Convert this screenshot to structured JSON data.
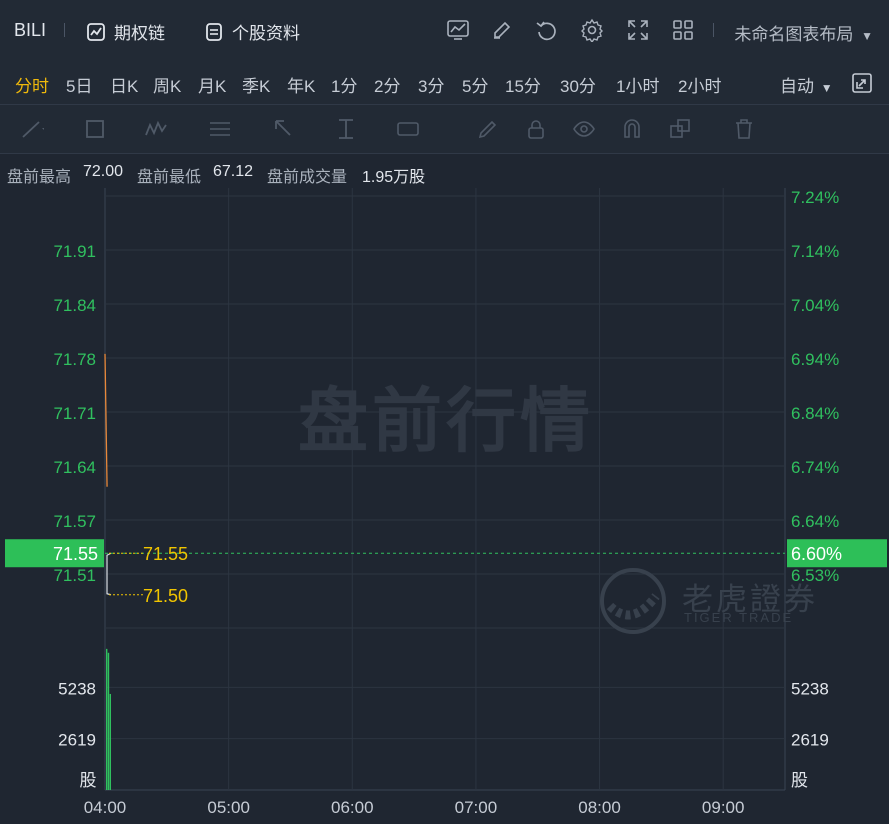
{
  "header": {
    "symbol": "BILI",
    "options_chain": "期权链",
    "stock_profile": "个股资料",
    "layout_name": "未命名图表布局"
  },
  "periods": [
    "分时",
    "5日",
    "日K",
    "周K",
    "月K",
    "季K",
    "年K",
    "1分",
    "2分",
    "3分",
    "5分",
    "15分",
    "30分",
    "1小时",
    "2小时"
  ],
  "active_period": "分时",
  "scale_mode": "自动",
  "premarket": {
    "high_label": "盘前最高",
    "high_value": "72.00",
    "low_label": "盘前最低",
    "low_value": "67.12",
    "volume_label": "盘前成交量",
    "volume_value": "1.95万股"
  },
  "watermark": "盘前行情",
  "logo": {
    "cn": "老虎證券",
    "en": "TIGER TRADE"
  },
  "colors": {
    "up": "#30c05f",
    "price_line": "#e8883a",
    "avg_price": "#f0c400",
    "marker_bg": "#2dbf58",
    "grid": "#2c3541"
  },
  "chart_data": {
    "type": "line",
    "x_ticks": [
      "04:00",
      "05:00",
      "06:00",
      "07:00",
      "08:00",
      "09:00"
    ],
    "price_ticks_left": [
      "71.91",
      "71.84",
      "71.78",
      "71.71",
      "71.64",
      "71.57",
      "71.51"
    ],
    "price_ticks_right": [
      "7.24%",
      "7.14%",
      "7.04%",
      "6.94%",
      "6.84%",
      "6.74%",
      "6.64%",
      "6.53%"
    ],
    "price_ylim": [
      71.46,
      71.98
    ],
    "price_series": [
      {
        "x": "04:00",
        "y": 71.79
      },
      {
        "x": "04:01",
        "y": 71.63
      }
    ],
    "current_price": "71.55",
    "current_pct": "6.60%",
    "price_labels": [
      {
        "text": "71.55",
        "price": 71.55
      },
      {
        "text": "71.50",
        "price": 71.5
      }
    ],
    "volume_ticks": [
      "5238",
      "2619"
    ],
    "volume_unit": "股",
    "volume_ylim": [
      0,
      7857
    ],
    "volume_bars": [
      {
        "x": "04:00",
        "v": 7200
      },
      {
        "x": "04:01",
        "v": 7000
      },
      {
        "x": "04:02",
        "v": 4900
      }
    ]
  }
}
